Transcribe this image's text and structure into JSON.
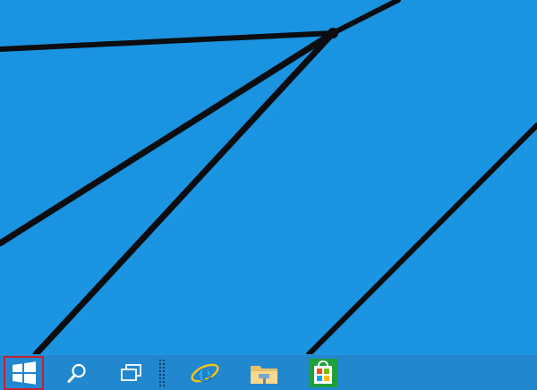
{
  "desktop": {
    "wallpaper_color": "#1a93e0",
    "line_color": "#0b0d10"
  },
  "taskbar": {
    "background_color": "#2187cf",
    "start_highlight_color": "#c42231",
    "items": [
      {
        "name": "start",
        "icon": "windows-logo-icon"
      },
      {
        "name": "search",
        "icon": "search-icon"
      },
      {
        "name": "task-view",
        "icon": "task-view-icon"
      },
      {
        "name": "grip",
        "icon": "grip-dots-icon"
      },
      {
        "name": "internet-explorer",
        "icon": "internet-explorer-icon"
      },
      {
        "name": "file-explorer",
        "icon": "folder-icon"
      },
      {
        "name": "store",
        "icon": "store-bag-icon"
      }
    ]
  }
}
